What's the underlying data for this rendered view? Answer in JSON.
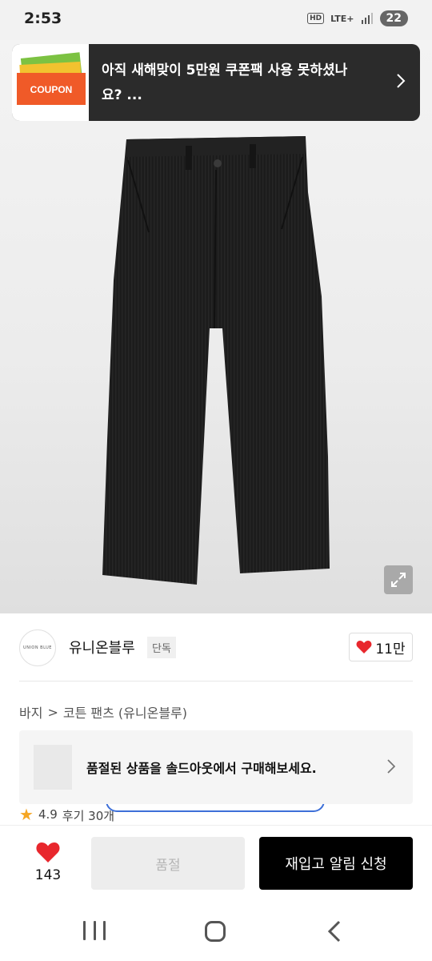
{
  "status_bar": {
    "time": "2:53",
    "hd": "HD",
    "network": "LTE+",
    "battery": "22"
  },
  "coupon_banner": {
    "badge": "COUPON",
    "text": "아직 새해맞이 5만원 쿠폰팩 사용 못하셨나요? ..."
  },
  "brand": {
    "logo_text": "UNION BLUE",
    "name": "유니온블루",
    "badge": "단독",
    "like_count": "11만"
  },
  "breadcrumb": {
    "category": "바지",
    "separator": ">",
    "item": "코튼 팬츠 (유니온블루)"
  },
  "soldout_banner": {
    "text": "품절된 상품을 솔드아웃에서 구매해보세요."
  },
  "rating": {
    "score": "4.9",
    "reviews": "후기 30개"
  },
  "bottom_bar": {
    "wish_count": "143",
    "soldout_label": "품절",
    "restock_label": "재입고 알림 신청"
  },
  "colors": {
    "accent_black": "#000000",
    "heart_red": "#e8272d",
    "coupon_orange": "#f05a28",
    "banner_dark": "#2b2b2b"
  }
}
